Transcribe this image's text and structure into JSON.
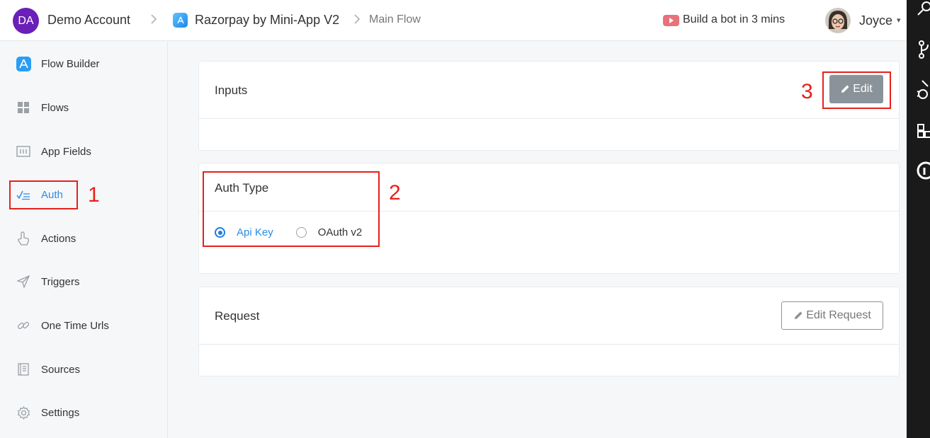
{
  "header": {
    "account_initials": "DA",
    "account_name": "Demo Account",
    "breadcrumb_sep": ">",
    "app_name": "Razorpay by Mini-App V2",
    "flow_name": "Main Flow",
    "promo_text": "Build a bot in 3 mins",
    "user_name": "Joyce",
    "user_caret": "▾"
  },
  "sidebar": {
    "items": [
      {
        "label": "Flow Builder",
        "icon": "app-store-icon"
      },
      {
        "label": "Flows",
        "icon": "grid-icon"
      },
      {
        "label": "App Fields",
        "icon": "fields-icon"
      },
      {
        "label": "Auth",
        "icon": "checklist-icon"
      },
      {
        "label": "Actions",
        "icon": "hand-pointer-icon"
      },
      {
        "label": "Triggers",
        "icon": "paper-plane-icon"
      },
      {
        "label": "One Time Urls",
        "icon": "link-icon"
      },
      {
        "label": "Sources",
        "icon": "book-icon"
      },
      {
        "label": "Settings",
        "icon": "gear-icon"
      }
    ],
    "active": "Auth"
  },
  "inputs_card": {
    "title": "Inputs",
    "edit_label": "Edit"
  },
  "auth_card": {
    "title": "Auth Type",
    "options": [
      "Api Key",
      "OAuth v2"
    ],
    "selected": "Api Key"
  },
  "request_card": {
    "title": "Request",
    "edit_label": "Edit Request"
  },
  "annotations": {
    "one": "1",
    "two": "2",
    "three": "3"
  },
  "colors": {
    "accent": "#2d8ce3",
    "annotation": "#e8201a",
    "avatar": "#6a1fb8"
  }
}
